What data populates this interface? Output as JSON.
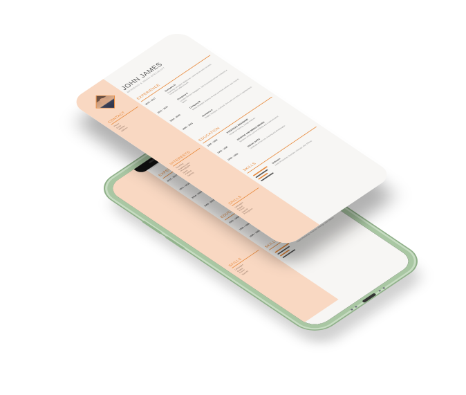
{
  "resume": {
    "name": "JOHN JAMES",
    "subtitle": "BRANDING & MEDIA SPECIALIST",
    "photo_icon": "portrait-photo",
    "accent_color": "#e88a3c",
    "sidebar_color": "#f9d8c2",
    "contact": {
      "title": "CONTACT",
      "lines": [
        "Phone",
        "Email",
        "Website",
        "Address"
      ]
    },
    "interests": {
      "title": "INTERESTS",
      "lines": [
        "Travelling",
        "Reading books",
        "Photography",
        "Music",
        "Painting",
        "Gaming"
      ]
    },
    "sidebar_skills": {
      "title": "SKILLS",
      "lines": [
        "Languages",
        "English",
        "French",
        "Spanish",
        "Portuguese"
      ]
    },
    "experience": {
      "title": "EXPERIENCE",
      "entries": [
        {
          "year": "2015 - 2017",
          "company": "Company D",
          "body": "Branding Consultant, Melbourne. Lorem ipsum dolor sit amet, consectetur adipiscing elit."
        },
        {
          "year": "2011 - 2015",
          "company": "Company C",
          "body": "Creative Director, Singapore. Sed do eiusmod tempor incididunt ut labore."
        },
        {
          "year": "2004 - 2009",
          "company": "Company B",
          "body": "Media Strategist, Sydney. Ut enim ad minim veniam, quis nostrud."
        },
        {
          "year": "1999 - 2003",
          "company": "Company A",
          "body": "Graphic Designer, Auckland. Duis aute irure dolor in reprehenderit."
        }
      ]
    },
    "education": {
      "title": "EDUCATION",
      "entries": [
        {
          "year": "1995 - 1999",
          "company": "STRATEGIC BRANDING",
          "body": "Advanced Diploma, Design Institute."
        },
        {
          "year": "1993 - 1995",
          "company": "GRAPHIC AND MEDIA DESIGN",
          "body": "Bachelor of Arts, School of Media and Communication."
        },
        {
          "year": "1990 - 1992",
          "company": "VISUAL ARTS",
          "body": "Certificate in Fine Arts, drawing and photography."
        }
      ]
    },
    "skills": {
      "title": "SKILLS",
      "label": "Software",
      "body": "Adobe Photoshop, Illustrator, InDesign, After Effects",
      "levels": [
        0.9,
        0.75,
        0.6,
        0.8
      ]
    }
  }
}
